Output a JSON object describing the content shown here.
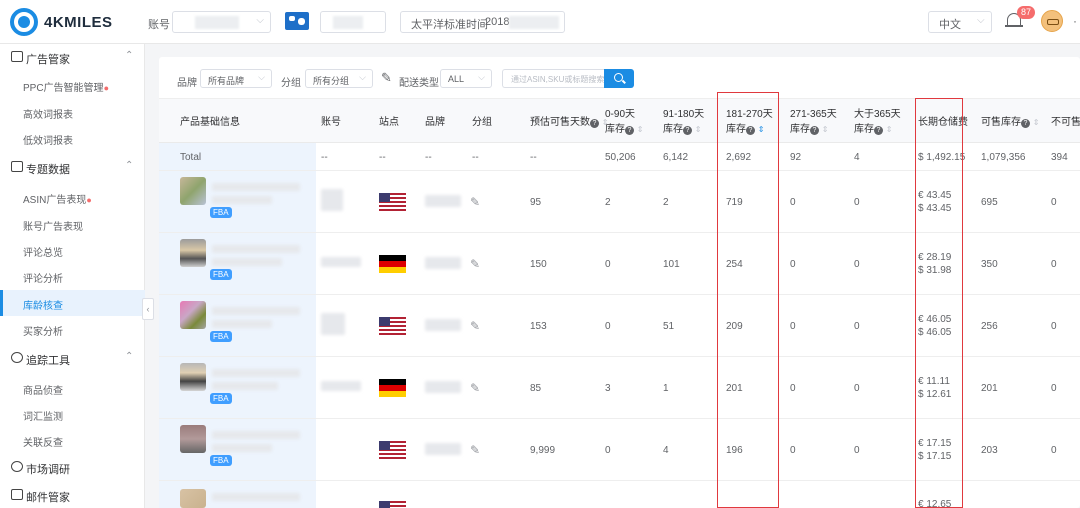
{
  "header": {
    "brand": "4KMILES",
    "account_label": "账号",
    "timezone": "太平洋标准时间",
    "date": "2018",
    "language": "中文",
    "notification_count": "87"
  },
  "sidebar": {
    "groups": [
      {
        "label": "广告管家",
        "items": [
          "PPC广告智能管理",
          "高效词报表",
          "低效词报表"
        ]
      },
      {
        "label": "专题数据",
        "items": [
          "ASIN广告表现",
          "账号广告表现",
          "评论总览",
          "评论分析",
          "库龄核查",
          "买家分析"
        ]
      },
      {
        "label": "追踪工具",
        "items": [
          "商品侦查",
          "词汇监测",
          "关联反查"
        ]
      },
      {
        "label": "市场调研",
        "items": []
      },
      {
        "label": "邮件管家",
        "items": []
      }
    ],
    "active_item": "库龄核查"
  },
  "filters": {
    "brand_label": "品牌",
    "brand_value": "所有品牌",
    "group_label": "分组",
    "group_value": "所有分组",
    "ship_type_label": "配送类型",
    "ship_type_value": "ALL",
    "search_placeholder": "通过ASIN,SKU或标题搜索"
  },
  "table": {
    "columns": {
      "product": "产品基础信息",
      "account": "账号",
      "site": "站点",
      "brand": "品牌",
      "group": "分组",
      "est_days": "预估可售天数",
      "d0_90_l1": "0-90天",
      "d0_90_l2": "库存",
      "d91_180_l1": "91-180天",
      "d91_180_l2": "库存",
      "d181_270_l1": "181-270天",
      "d181_270_l2": "库存",
      "d271_365_l1": "271-365天",
      "d271_365_l2": "库存",
      "d365_l1": "大于365天",
      "d365_l2": "库存",
      "lt_fee": "长期仓储费",
      "sellable": "可售库存",
      "unsellable": "不可售库"
    },
    "total": {
      "label": "Total",
      "account": "--",
      "site": "--",
      "brand": "--",
      "group": "--",
      "est_days": "--",
      "d0_90": "50,206",
      "d91_180": "6,142",
      "d181_270": "2,692",
      "d271_365": "92",
      "d365": "4",
      "lt_fee": "$ 1,492.15",
      "sellable": "1,079,356",
      "unsellable": "394"
    },
    "rows": [
      {
        "flag": "us",
        "est_days": "95",
        "d0_90": "2",
        "d91_180": "2",
        "d181_270": "719",
        "d271_365": "0",
        "d365": "0",
        "fee1": "€ 43.45",
        "fee2": "$ 43.45",
        "sellable": "695",
        "unsellable": "0",
        "fba": "FBA"
      },
      {
        "flag": "de",
        "est_days": "150",
        "d0_90": "0",
        "d91_180": "101",
        "d181_270": "254",
        "d271_365": "0",
        "d365": "0",
        "fee1": "€ 28.19",
        "fee2": "$ 31.98",
        "sellable": "350",
        "unsellable": "0",
        "fba": "FBA"
      },
      {
        "flag": "us",
        "est_days": "153",
        "d0_90": "0",
        "d91_180": "51",
        "d181_270": "209",
        "d271_365": "0",
        "d365": "0",
        "fee1": "€ 46.05",
        "fee2": "$ 46.05",
        "sellable": "256",
        "unsellable": "0",
        "fba": "FBA"
      },
      {
        "flag": "de",
        "est_days": "85",
        "d0_90": "3",
        "d91_180": "1",
        "d181_270": "201",
        "d271_365": "0",
        "d365": "0",
        "fee1": "€ 11.11",
        "fee2": "$ 12.61",
        "sellable": "201",
        "unsellable": "0",
        "fba": "FBA"
      },
      {
        "flag": "us",
        "est_days": "9,999",
        "d0_90": "0",
        "d91_180": "4",
        "d181_270": "196",
        "d271_365": "0",
        "d365": "0",
        "fee1": "€ 17.15",
        "fee2": "$ 17.15",
        "sellable": "203",
        "unsellable": "0",
        "fba": "FBA"
      },
      {
        "flag": "us",
        "fee1": "€ 12.65"
      }
    ]
  },
  "colors": {
    "accent": "#1b8ce3",
    "highlight": "#e0393e",
    "active_bg": "#e8f2fd"
  }
}
